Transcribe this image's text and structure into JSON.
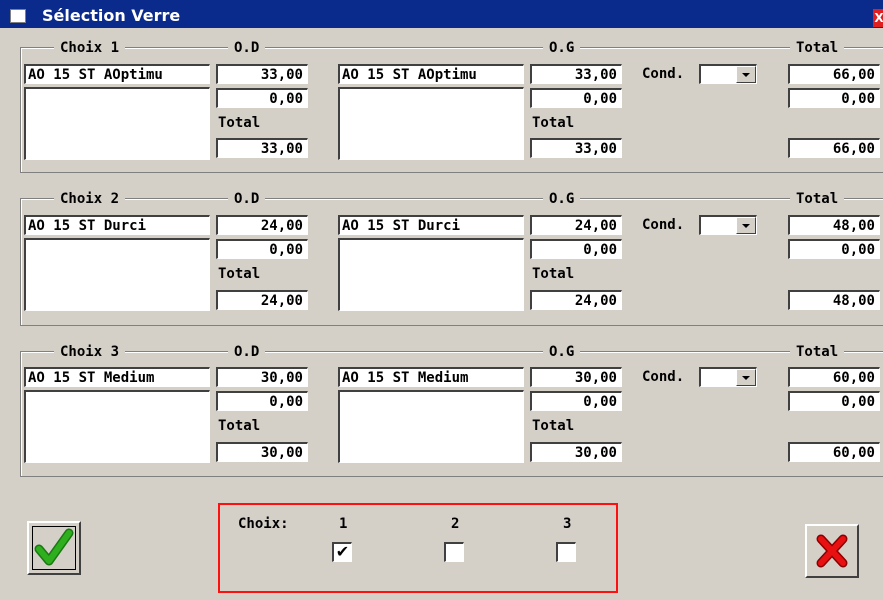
{
  "window": {
    "title": "Sélection Verre",
    "close_glyph": "X"
  },
  "headers": {
    "od": "O.D",
    "og": "O.G",
    "total": "Total",
    "total_sub": "Total",
    "cond": "Cond."
  },
  "groups": [
    {
      "label": "Choix 1",
      "od_desc": "AO 15 ST AOptimu",
      "od_val": "33,00",
      "od_val2": "0,00",
      "od_total": "33,00",
      "og_desc": "AO 15 ST AOptimu",
      "og_val": "33,00",
      "og_val2": "0,00",
      "og_total": "33,00",
      "total_val": "66,00",
      "total_val2": "0,00",
      "total_total": "66,00"
    },
    {
      "label": "Choix 2",
      "od_desc": "AO 15 ST Durci",
      "od_val": "24,00",
      "od_val2": "0,00",
      "od_total": "24,00",
      "og_desc": "AO 15 ST Durci",
      "og_val": "24,00",
      "og_val2": "0,00",
      "og_total": "24,00",
      "total_val": "48,00",
      "total_val2": "0,00",
      "total_total": "48,00"
    },
    {
      "label": "Choix 3",
      "od_desc": "AO 15 ST Medium",
      "od_val": "30,00",
      "od_val2": "0,00",
      "od_total": "30,00",
      "og_desc": "AO 15 ST Medium",
      "og_val": "30,00",
      "og_val2": "0,00",
      "og_total": "30,00",
      "total_val": "60,00",
      "total_val2": "0,00",
      "total_total": "60,00"
    }
  ],
  "choix": {
    "label": "Choix:",
    "options": [
      "1",
      "2",
      "3"
    ],
    "checked": "1",
    "check_glyph": "✔"
  },
  "buttons": {
    "ok_icon": "green-check-icon",
    "cancel_icon": "red-x-icon"
  },
  "colors": {
    "titlebar": "#0a2a8c",
    "highlight": "#ff1010",
    "ok": "#2fae1e",
    "cancel": "#e81010"
  }
}
